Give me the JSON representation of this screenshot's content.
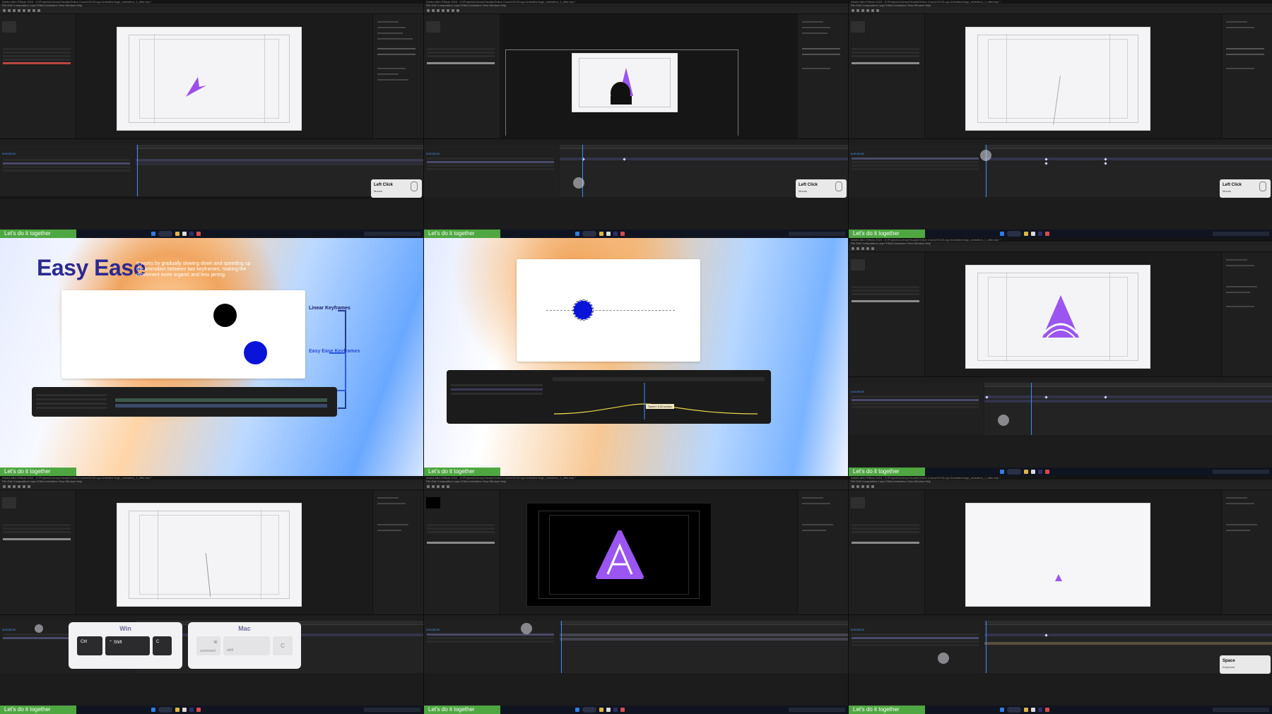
{
  "badge_text": "Let's do it together",
  "ae": {
    "title_text": "Adobe After Effects 2024 - D:\\Projects\\Udemy\\Visuals\\Online Course\\S10\\Logo Animation\\logo_animation_1_after.aep *",
    "menu_text": "File  Edit  Composition  Layer  Effect  Animation  View  Window  Help",
    "timecode": "0;00;00;00",
    "colors": {
      "panel": "#1c1c1c",
      "accent_blue": "#3b8cff",
      "selected_layer": "#b9463f"
    }
  },
  "popups": {
    "left_click": {
      "title": "Left Click",
      "sub": "Mouse"
    },
    "space": {
      "title": "Space",
      "sub": "Keyboard"
    }
  },
  "slide1": {
    "title": "Easy Ease",
    "desc": "It works by gradually slowing down and speeding up the animation between two keyframes, making the movement more organic and less jarring.",
    "linear_label": "Linear Keyframes",
    "ease_label": "Easy Ease Keyframes",
    "colors": {
      "title": "#2b2a8f",
      "ball_linear": "#000000",
      "ball_ease": "#0a14d8"
    }
  },
  "slide2": {
    "tooltip": "Speed: 0.00 px/sec",
    "colors": {
      "ball": "#0a14d8"
    }
  },
  "shortcut": {
    "win_title": "Win",
    "mac_title": "Mac",
    "win_keys": [
      "Ctrl",
      "⌃ Shift",
      "C"
    ],
    "mac_keys": [
      {
        "symbol": "⌘",
        "label": "command"
      },
      {
        "symbol": "",
        "label": "shift"
      },
      {
        "symbol": "C",
        "label": ""
      }
    ]
  },
  "taskbar": {
    "search_label": "Search"
  }
}
